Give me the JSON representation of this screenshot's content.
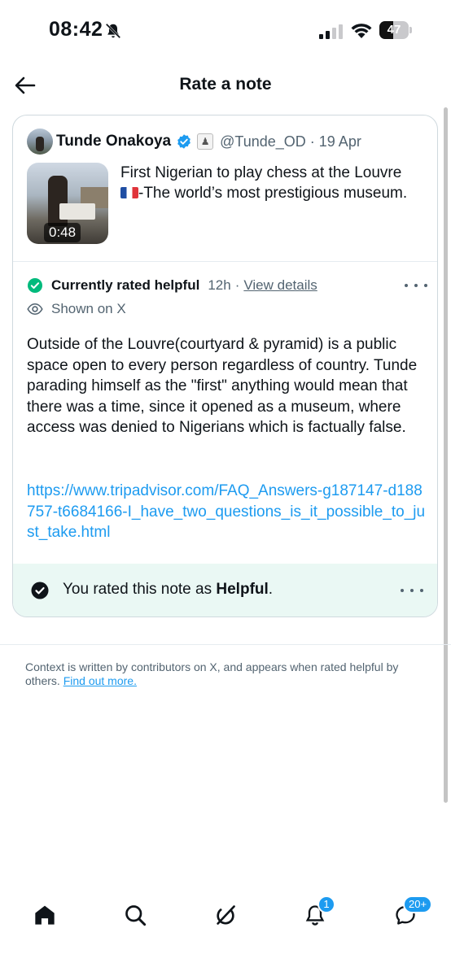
{
  "status_bar": {
    "time": "08:42",
    "battery": "47",
    "battery_level": 0.47
  },
  "header": {
    "title": "Rate a note"
  },
  "tweet": {
    "author_name": "Tunde Onakoya",
    "handle": "@Tunde_OD",
    "separator": "·",
    "date": "19 Apr",
    "text_line1": "First Nigerian to play chess at the Louvre",
    "text_line2": "-The world’s most prestigious museum.",
    "flag": "flag-france-icon",
    "video_duration": "0:48"
  },
  "note": {
    "status": "Currently rated helpful",
    "age": "12h",
    "separator": "·",
    "view_details": "View details",
    "shown_on": "Shown on X",
    "body": "Outside of the Louvre(courtyard & pyramid) is a public space open to every person regardless of country. Tunde parading himself as the \"first\" anything would mean that there was a time, since it opened as a museum, where access was denied to Nigerians which is factually false.",
    "link": "https://www.tripadvisor.com/FAQ_Answers-g187147-d188757-t6684166-I_have_two_questions_is_it_possible_to_just_take.html"
  },
  "rating": {
    "prefix": "You rated this note as ",
    "value": "Helpful",
    "suffix": "."
  },
  "context": {
    "text": "Context is written by contributors on X, and appears when rated helpful by others. ",
    "link": "Find out more."
  },
  "nav": {
    "items": [
      {
        "icon": "home-icon"
      },
      {
        "icon": "search-icon"
      },
      {
        "icon": "grok-icon"
      },
      {
        "icon": "notifications-icon",
        "badge": "1"
      },
      {
        "icon": "messages-icon",
        "badge": "20+"
      }
    ]
  },
  "colors": {
    "accent": "#1d9bf0",
    "helpful_green": "#00ba7c",
    "rated_bg": "#eaf8f4",
    "secondary_text": "#536471"
  }
}
